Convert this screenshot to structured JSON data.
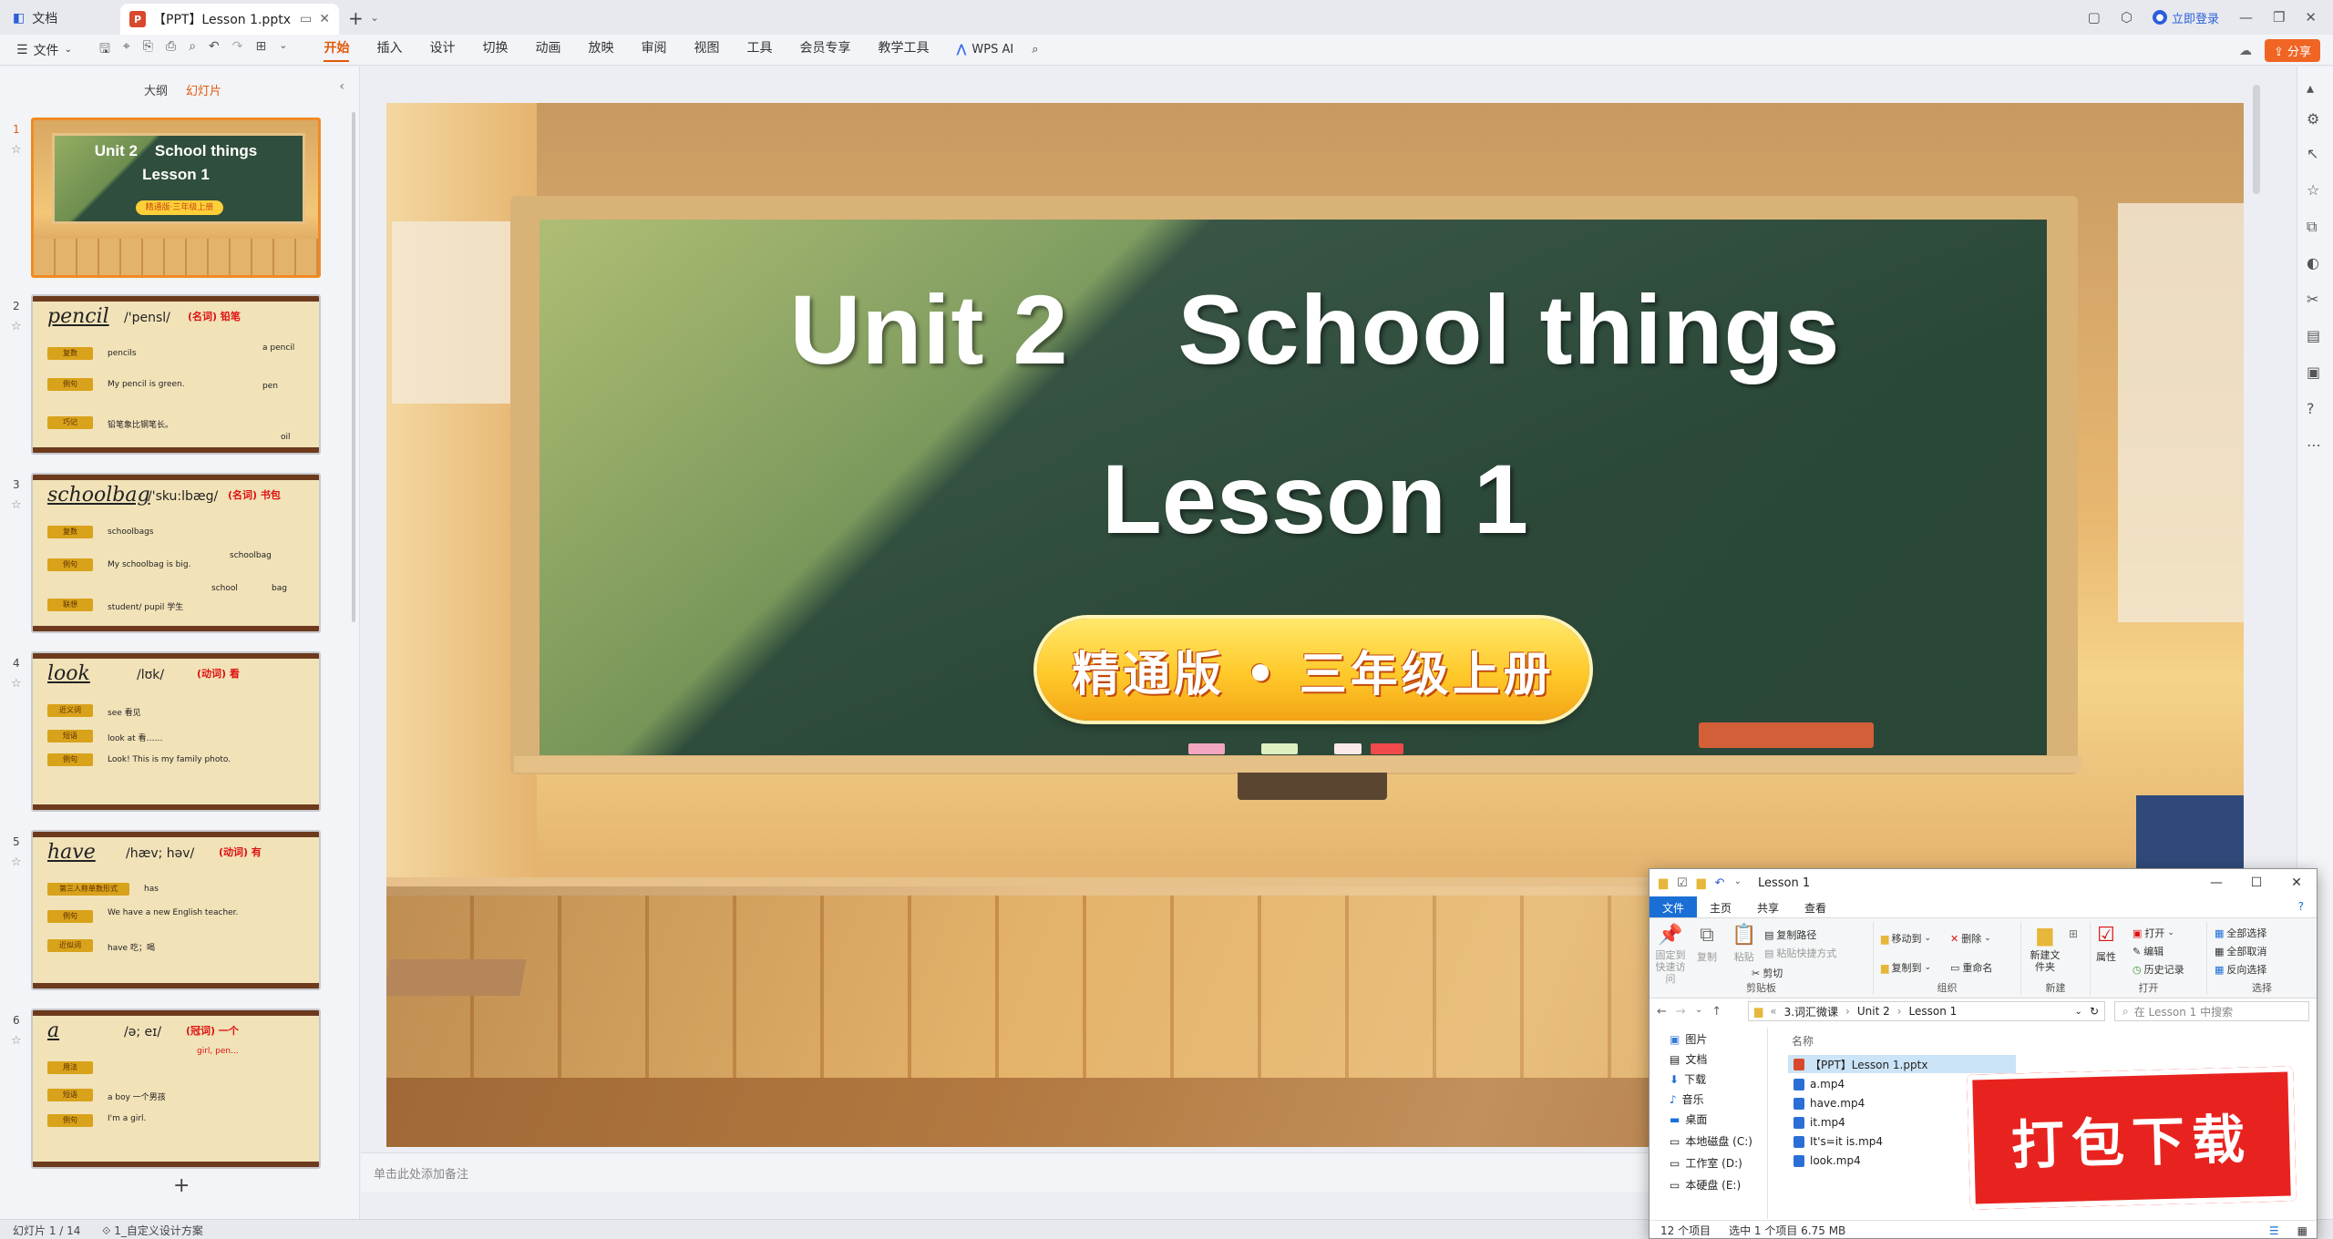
{
  "titlebar": {
    "home_tab": "文档",
    "doc_tab": "【PPT】Lesson 1.pptx",
    "ppt_badge": "P",
    "login": "立即登录"
  },
  "ribbon": {
    "file": "文件",
    "menus": [
      "开始",
      "插入",
      "设计",
      "切换",
      "动画",
      "放映",
      "审阅",
      "视图",
      "工具",
      "会员专享",
      "教学工具"
    ],
    "active_menu": "开始",
    "wps_ai": "WPS AI",
    "share": "分享"
  },
  "left_panel": {
    "tab_outline": "大纲",
    "tab_slides": "幻灯片",
    "slide_numbers": [
      "1",
      "2",
      "3",
      "4",
      "5",
      "6"
    ],
    "thumb1": {
      "title": "Unit 2    School things",
      "sub": "Lesson 1",
      "badge": "精通版·三年级上册"
    },
    "thumb2": {
      "word": "pencil",
      "ipa": "/'pensl/",
      "pos": "(名词) 铅笔",
      "tag1": "复数",
      "val1": "pencils",
      "tag2": "例句",
      "val2": "My pencil is green.",
      "tag3": "巧记",
      "val3": "铅笔象比钢笔长。",
      "extra1": "a pencil",
      "extra2": "pen",
      "extra3": "oil"
    },
    "thumb3": {
      "word": "schoolbag",
      "ipa": "/'sku:lbæg/",
      "pos": "(名词) 书包",
      "tag1": "复数",
      "val1": "schoolbags",
      "tag2": "例句",
      "val2": "My schoolbag is big.",
      "tag3": "联想",
      "val3": "student/ pupil  学生",
      "extra1": "schoolbag",
      "extra2": "school",
      "extra3": "bag"
    },
    "thumb4": {
      "word": "look",
      "ipa": "/lʊk/",
      "pos": "(动词) 看",
      "tag1": "近义词",
      "val1": "see  看见",
      "tag2": "短语",
      "val2": "look at  看……",
      "tag3": "例句",
      "val3": "Look! This is my family photo."
    },
    "thumb5": {
      "word": "have",
      "ipa": "/hæv; həv/",
      "pos": "(动词) 有",
      "tag1": "第三人称单数形式",
      "val1": "has",
      "tag2": "例句",
      "val2": "We have a new English teacher.",
      "tag3": "近似词",
      "val3": "have  吃；喝"
    },
    "thumb6": {
      "word": "a",
      "ipa": "/ə; eɪ/",
      "pos": "(冠词) 一个",
      "tag1": "用法",
      "val1": "girl, pen...",
      "tag2": "短语",
      "val2": "a boy  一个男孩",
      "tag3": "例句",
      "val3": "I'm a girl."
    },
    "add_slide": "+"
  },
  "slide": {
    "title_part1": "Unit 2",
    "title_part2": "School things",
    "subtitle": "Lesson 1",
    "badge": "精通版 • 三年级上册"
  },
  "notes_placeholder": "单击此处添加备注",
  "status": {
    "slide_count": "幻灯片 1 / 14",
    "theme": "1_自定义设计方案"
  },
  "explorer": {
    "title": "Lesson 1",
    "tabs": [
      "文件",
      "主页",
      "共享",
      "查看"
    ],
    "ribbon": {
      "pin": "固定到快速访问",
      "copy": "复制",
      "paste": "粘贴",
      "copy_path": "复制路径",
      "paste_shortcut": "粘贴快捷方式",
      "cut": "剪切",
      "clipboard": "剪贴板",
      "move_to": "移动到",
      "delete": "删除",
      "copy_to": "复制到",
      "rename": "重命名",
      "organize": "组织",
      "new_folder": "新建文件夹",
      "new": "新建",
      "properties": "属性",
      "open": "打开",
      "edit": "编辑",
      "history": "历史记录",
      "open_group": "打开",
      "select_all": "全部选择",
      "select_none": "全部取消",
      "invert": "反向选择",
      "select": "选择"
    },
    "address": [
      "3.词汇微课",
      "Unit 2",
      "Lesson 1"
    ],
    "search_placeholder": "在 Lesson 1 中搜索",
    "nav": [
      "图片",
      "文档",
      "下载",
      "音乐",
      "桌面",
      "本地磁盘 (C:)",
      "工作室 (D:)",
      "本硬盘 (E:)"
    ],
    "column_name": "名称",
    "files": [
      "【PPT】Lesson 1.pptx",
      "a.mp4",
      "have.mp4",
      "it.mp4",
      "It's=it is.mp4",
      "look.mp4"
    ],
    "status_items": "12 个项目",
    "status_selected": "选中 1 个项目  6.75 MB"
  },
  "stamp_text": "打包下载",
  "colors": {
    "accent": "#e0590b",
    "share": "#f06524",
    "explorer_file_tab": "#1a6fd6",
    "stamp": "#e8231f"
  }
}
